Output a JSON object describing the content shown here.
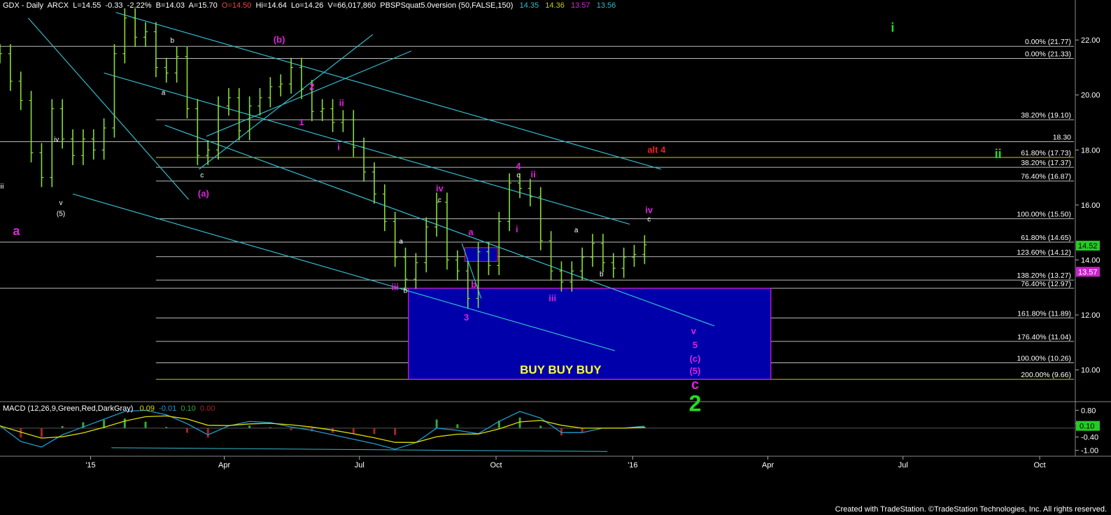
{
  "header": {
    "symbol": "GDX - Daily",
    "exchange": "ARCX",
    "last": "L=14.55",
    "change": "-0.33",
    "pct": "-2.22%",
    "bid": "B=14.03",
    "ask": "A=15.70",
    "open": "O=14.50",
    "high": "Hi=14.64",
    "low": "Lo=14.26",
    "volume": "V=66,017,860",
    "indicator": "PBSPSquat5.0version (50,FALSE,150)",
    "ind_vals": [
      "14.35",
      "14.36",
      "13.57",
      "13.56"
    ]
  },
  "macd": {
    "label": "MACD (12,26,9,Green,Red,DarkGray)",
    "vals": [
      "0.09",
      "-0.01",
      "0.10",
      "0.00"
    ]
  },
  "footer": "Created with TradeStation. ©TradeStation Technologies, Inc. All rights reserved.",
  "colors": {
    "price": "#88dd33",
    "grid": "#c8c8c8",
    "channel": "#33bbcc",
    "magenta": "#dd22dd",
    "green": "#22dd22",
    "red": "#ee2222",
    "blue_box": "#0000aa",
    "gold": "#cccc00",
    "macd_line": "#2299cc",
    "signal_line": "#dddd00",
    "hist_pos": "#33aa33",
    "hist_neg": "#aa2222"
  },
  "chart_data": {
    "type": "line",
    "title": "GDX - Daily",
    "x_ticks": [
      "'15",
      "Apr",
      "Jul",
      "Oct",
      "'16",
      "Apr",
      "Jul",
      "Oct"
    ],
    "y_ticks": [
      "22.00",
      "20.00",
      "18.00",
      "16.00",
      "14.00",
      "12.00",
      "10.00"
    ],
    "ylim": [
      9.0,
      23.2
    ],
    "price_tags": [
      {
        "text": "14.52",
        "y": 14.52,
        "color": "#22cc22",
        "text_color": "#000000"
      },
      {
        "text": "13.57",
        "y": 13.57,
        "color": "#cc22cc",
        "text_color": "#ffffff"
      }
    ],
    "series": [
      {
        "name": "GDX",
        "points": [
          [
            "2014-11-01",
            21.5
          ],
          [
            "2014-11-08",
            20.5
          ],
          [
            "2014-11-15",
            19.8
          ],
          [
            "2014-11-22",
            17.9
          ],
          [
            "2014-11-29",
            17.0
          ],
          [
            "2014-12-06",
            19.5
          ],
          [
            "2014-12-13",
            18.4
          ],
          [
            "2014-12-20",
            17.8
          ],
          [
            "2014-12-27",
            18.4
          ],
          [
            "2015-01-03",
            18.0
          ],
          [
            "2015-01-10",
            18.8
          ],
          [
            "2015-01-17",
            21.5
          ],
          [
            "2015-01-24",
            22.8
          ],
          [
            "2015-01-31",
            22.1
          ],
          [
            "2015-02-07",
            22.3
          ],
          [
            "2015-02-14",
            21.0
          ],
          [
            "2015-02-21",
            20.8
          ],
          [
            "2015-02-28",
            21.4
          ],
          [
            "2015-03-07",
            19.5
          ],
          [
            "2015-03-14",
            17.8
          ],
          [
            "2015-03-21",
            18.0
          ],
          [
            "2015-03-28",
            19.6
          ],
          [
            "2015-04-04",
            19.9
          ],
          [
            "2015-04-11",
            18.7
          ],
          [
            "2015-04-18",
            19.6
          ],
          [
            "2015-04-25",
            19.9
          ],
          [
            "2015-05-02",
            20.3
          ],
          [
            "2015-05-09",
            20.4
          ],
          [
            "2015-05-16",
            21.0
          ],
          [
            "2015-05-23",
            20.2
          ],
          [
            "2015-05-30",
            19.4
          ],
          [
            "2015-06-06",
            19.5
          ],
          [
            "2015-06-13",
            19.0
          ],
          [
            "2015-06-20",
            19.1
          ],
          [
            "2015-06-27",
            18.1
          ],
          [
            "2015-07-04",
            17.2
          ],
          [
            "2015-07-11",
            16.4
          ],
          [
            "2015-07-18",
            15.4
          ],
          [
            "2015-07-25",
            14.1
          ],
          [
            "2015-08-01",
            13.3
          ],
          [
            "2015-08-08",
            13.9
          ],
          [
            "2015-08-15",
            15.2
          ],
          [
            "2015-08-22",
            16.1
          ],
          [
            "2015-08-29",
            14.0
          ],
          [
            "2015-09-05",
            13.6
          ],
          [
            "2015-09-12",
            12.6
          ],
          [
            "2015-09-19",
            14.3
          ],
          [
            "2015-09-26",
            13.8
          ],
          [
            "2015-10-03",
            15.4
          ],
          [
            "2015-10-10",
            16.8
          ],
          [
            "2015-10-17",
            16.6
          ],
          [
            "2015-10-24",
            16.3
          ],
          [
            "2015-10-31",
            14.7
          ],
          [
            "2015-11-07",
            13.6
          ],
          [
            "2015-11-14",
            13.2
          ],
          [
            "2015-11-21",
            13.6
          ],
          [
            "2015-11-28",
            14.1
          ],
          [
            "2015-12-05",
            14.6
          ],
          [
            "2015-12-12",
            13.9
          ],
          [
            "2015-12-19",
            13.7
          ],
          [
            "2015-12-26",
            14.1
          ],
          [
            "2016-01-02",
            14.2
          ],
          [
            "2016-01-09",
            14.55
          ]
        ]
      },
      {
        "name": "MACD",
        "points": [
          [
            "2014-11-01",
            0.1
          ],
          [
            "2014-11-15",
            -0.6
          ],
          [
            "2014-11-29",
            -0.85
          ],
          [
            "2014-12-13",
            -0.3
          ],
          [
            "2014-12-27",
            0.05
          ],
          [
            "2015-01-10",
            0.4
          ],
          [
            "2015-01-24",
            0.75
          ],
          [
            "2015-02-07",
            0.8
          ],
          [
            "2015-02-21",
            0.6
          ],
          [
            "2015-03-07",
            0.2
          ],
          [
            "2015-03-21",
            -0.3
          ],
          [
            "2015-04-04",
            0.1
          ],
          [
            "2015-04-18",
            0.3
          ],
          [
            "2015-05-02",
            0.25
          ],
          [
            "2015-05-16",
            0.05
          ],
          [
            "2015-05-30",
            -0.1
          ],
          [
            "2015-06-13",
            -0.3
          ],
          [
            "2015-06-27",
            -0.5
          ],
          [
            "2015-07-11",
            -0.7
          ],
          [
            "2015-07-25",
            -0.95
          ],
          [
            "2015-08-08",
            -0.65
          ],
          [
            "2015-08-22",
            0.0
          ],
          [
            "2015-09-05",
            -0.1
          ],
          [
            "2015-09-19",
            -0.25
          ],
          [
            "2015-10-03",
            0.3
          ],
          [
            "2015-10-17",
            0.75
          ],
          [
            "2015-10-31",
            0.45
          ],
          [
            "2015-11-14",
            -0.2
          ],
          [
            "2015-11-28",
            -0.2
          ],
          [
            "2015-12-12",
            0.0
          ],
          [
            "2015-12-26",
            0.0
          ],
          [
            "2016-01-09",
            0.09
          ]
        ]
      }
    ],
    "macd_axis": {
      "ticks": [
        "0.80",
        "0.20",
        "0.10",
        "-0.40",
        "-1.00"
      ],
      "ylim": [
        -1.2,
        1.0
      ]
    },
    "horizontal_levels": [
      {
        "label": "0.00% (21.77)",
        "y": 21.77
      },
      {
        "label": "0.00% (21.33)",
        "y": 21.33
      },
      {
        "label": "38.20% (19.10)",
        "y": 19.1
      },
      {
        "label": "18.30",
        "y": 18.3
      },
      {
        "label": "61.80% (17.73)",
        "y": 17.73
      },
      {
        "label": "38.20% (17.37)",
        "y": 17.37
      },
      {
        "label": "76.40% (16.87)",
        "y": 16.87
      },
      {
        "label": "100.00% (15.50)",
        "y": 15.5
      },
      {
        "label": "61.80% (14.65)",
        "y": 14.65
      },
      {
        "label": "123.60% (14.12)",
        "y": 14.12
      },
      {
        "label": "138.20% (13.27)",
        "y": 13.27
      },
      {
        "label": "76.40% (12.97)",
        "y": 12.97
      },
      {
        "label": "161.80% (11.89)",
        "y": 11.89
      },
      {
        "label": "176.40% (11.04)",
        "y": 11.04
      },
      {
        "label": "100.00% (10.26)",
        "y": 10.26
      },
      {
        "label": "200.00% (9.66)",
        "y": 9.66
      }
    ],
    "buy_box": {
      "x_start": "2015-08-03",
      "x_end": "2016-04-03",
      "y_top": 12.97,
      "y_bottom": 9.66,
      "label": "BUY BUY BUY"
    },
    "annotations": [
      {
        "text": "a",
        "color": "magenta",
        "x": "2014-11-12",
        "y": 14.9
      },
      {
        "text": "iii",
        "color": "white",
        "x": "2014-11-02",
        "y": 16.6
      },
      {
        "text": "iv",
        "color": "white",
        "x": "2014-12-09",
        "y": 18.3
      },
      {
        "text": "v",
        "color": "white",
        "x": "2014-12-12",
        "y": 16.0
      },
      {
        "text": "(5)",
        "color": "white",
        "x": "2014-12-12",
        "y": 15.6
      },
      {
        "text": "b",
        "color": "white",
        "x": "2015-02-25",
        "y": 21.9
      },
      {
        "text": "a",
        "color": "white",
        "x": "2015-02-19",
        "y": 20.0
      },
      {
        "text": "c",
        "color": "white",
        "x": "2015-03-17",
        "y": 17.0
      },
      {
        "text": "(a)",
        "color": "magenta",
        "x": "2015-03-18",
        "y": 16.3
      },
      {
        "text": "(b)",
        "color": "magenta",
        "x": "2015-05-08",
        "y": 21.9
      },
      {
        "text": "2",
        "color": "magenta",
        "x": "2015-05-30",
        "y": 20.2
      },
      {
        "text": "1",
        "color": "magenta",
        "x": "2015-05-23",
        "y": 18.9
      },
      {
        "text": "ii",
        "color": "magenta",
        "x": "2015-06-19",
        "y": 19.6
      },
      {
        "text": "i",
        "color": "magenta",
        "x": "2015-06-17",
        "y": 18.0
      },
      {
        "text": "iv",
        "color": "magenta",
        "x": "2015-08-24",
        "y": 16.5
      },
      {
        "text": "c",
        "color": "white",
        "x": "2015-08-24",
        "y": 16.1
      },
      {
        "text": "a",
        "color": "white",
        "x": "2015-07-29",
        "y": 14.6
      },
      {
        "text": "iii",
        "color": "magenta",
        "x": "2015-07-25",
        "y": 12.9
      },
      {
        "text": "b",
        "color": "white",
        "x": "2015-08-01",
        "y": 12.8
      },
      {
        "text": "3",
        "color": "magenta",
        "x": "2015-09-11",
        "y": 11.8
      },
      {
        "text": "a",
        "color": "magenta",
        "x": "2015-09-14",
        "y": 14.9
      },
      {
        "text": "b",
        "color": "magenta",
        "x": "2015-09-16",
        "y": 13.0
      },
      {
        "text": "4",
        "color": "magenta",
        "x": "2015-10-16",
        "y": 17.3
      },
      {
        "text": "c",
        "color": "white",
        "x": "2015-10-16",
        "y": 17.0
      },
      {
        "text": "ii",
        "color": "magenta",
        "x": "2015-10-26",
        "y": 17.0
      },
      {
        "text": "i",
        "color": "magenta",
        "x": "2015-10-15",
        "y": 15.0
      },
      {
        "text": "a",
        "color": "white",
        "x": "2015-11-24",
        "y": 15.0
      },
      {
        "text": "iii",
        "color": "magenta",
        "x": "2015-11-08",
        "y": 12.5
      },
      {
        "text": "b",
        "color": "white",
        "x": "2015-12-11",
        "y": 13.4
      },
      {
        "text": "iv",
        "color": "magenta",
        "x": "2016-01-12",
        "y": 15.7
      },
      {
        "text": "c",
        "color": "white",
        "x": "2016-01-12",
        "y": 15.4
      },
      {
        "text": "alt 4",
        "color": "red",
        "x": "2016-01-17",
        "y": 17.9
      },
      {
        "text": "v",
        "color": "magenta",
        "x": "2016-02-11",
        "y": 11.3
      },
      {
        "text": "5",
        "color": "magenta",
        "x": "2016-02-12",
        "y": 10.8
      },
      {
        "text": "(c)",
        "color": "magenta",
        "x": "2016-02-12",
        "y": 10.3
      },
      {
        "text": "(5)",
        "color": "magenta",
        "x": "2016-02-12",
        "y": 9.85
      },
      {
        "text": "c",
        "color": "magenta",
        "x": "2016-02-12",
        "y": 9.3
      },
      {
        "text": "2",
        "color": "green",
        "x": "2016-02-12",
        "y": 8.5
      },
      {
        "text": "i",
        "color": "green",
        "x": "2016-06-24",
        "y": 22.3
      },
      {
        "text": "ii",
        "color": "green",
        "x": "2016-09-03",
        "y": 17.7
      }
    ]
  }
}
